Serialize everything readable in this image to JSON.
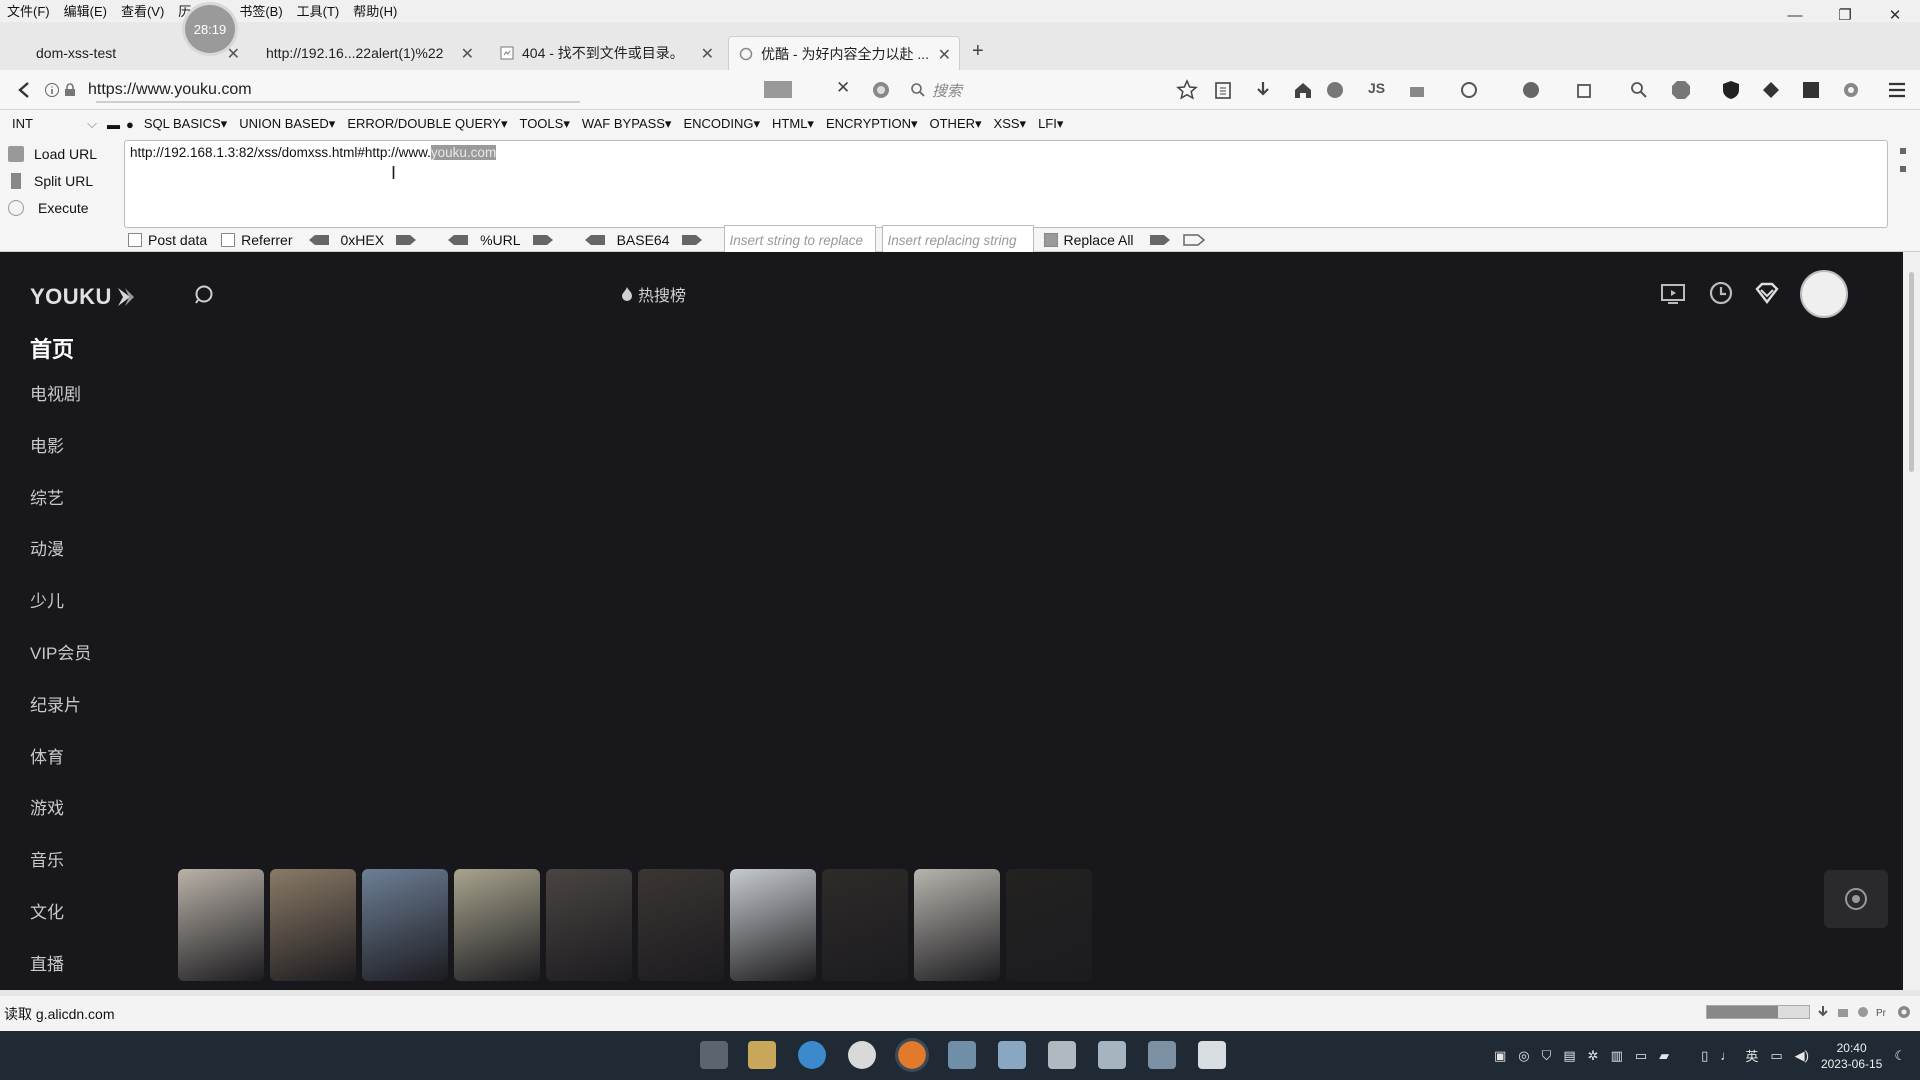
{
  "menubar": {
    "items": [
      "文件(F)",
      "编辑(E)",
      "查看(V)",
      "历",
      "书签(B)",
      "工具(T)",
      "帮助(H)"
    ]
  },
  "recording_timer": "28:19",
  "tabs": [
    {
      "label": "dom-xss-test"
    },
    {
      "label": "http://192.16...22alert(1)%22"
    },
    {
      "label": "404 - 找不到文件或目录。"
    },
    {
      "label": "优酷 - 为好内容全力以赴 ..."
    }
  ],
  "address": {
    "url": "https://www.youku.com"
  },
  "search": {
    "placeholder": "搜索"
  },
  "hackbar": {
    "type_select": "INT",
    "menus": [
      "SQL BASICS▾",
      "UNION BASED▾",
      "ERROR/DOUBLE QUERY▾",
      "TOOLS▾",
      "WAF BYPASS▾",
      "ENCODING▾",
      "HTML▾",
      "ENCRYPTION▾",
      "OTHER▾",
      "XSS▾",
      "LFI▾"
    ],
    "actions": [
      "Load URL",
      "Split URL",
      "Execute"
    ],
    "url_prefix": "http://192.168.1.3:82/xss/domxss.html#http://www.",
    "url_selected": "youku.com",
    "post_data": "Post data",
    "referrer": "Referrer",
    "hex": "0xHEX",
    "urlenc": "%URL",
    "base64": "BASE64",
    "replace_placeholder": "Insert string to replace",
    "replacing_placeholder": "Insert replacing string",
    "replace_all": "Replace All"
  },
  "youku": {
    "logo": "YOUKU",
    "hot": "热搜榜",
    "nav_home": "首页",
    "nav": [
      "电视剧",
      "电影",
      "综艺",
      "动漫",
      "少儿",
      "VIP会员",
      "纪录片",
      "体育",
      "游戏",
      "音乐",
      "文化",
      "直播"
    ],
    "thumbs": [
      {
        "caption": "",
        "color": "#b9b2a8"
      },
      {
        "caption": "",
        "color": "#8a7a66"
      },
      {
        "caption": "",
        "color": "#6d7f96"
      },
      {
        "caption": "",
        "color": "#a8a48e"
      },
      {
        "caption": "",
        "color": "#4a4542"
      },
      {
        "caption": "",
        "color": "#3b3633"
      },
      {
        "caption": "",
        "color": "#c6cbcf"
      },
      {
        "caption": "",
        "color": "#2e2b29"
      },
      {
        "caption": "",
        "color": "#b7b4ad"
      },
      {
        "caption": "",
        "color": "#232220"
      }
    ]
  },
  "status": {
    "text": "读取 g.alicdn.com"
  },
  "clock": {
    "time": "20:40",
    "date": "2023-06-15"
  },
  "tray": {
    "ime": "英"
  }
}
